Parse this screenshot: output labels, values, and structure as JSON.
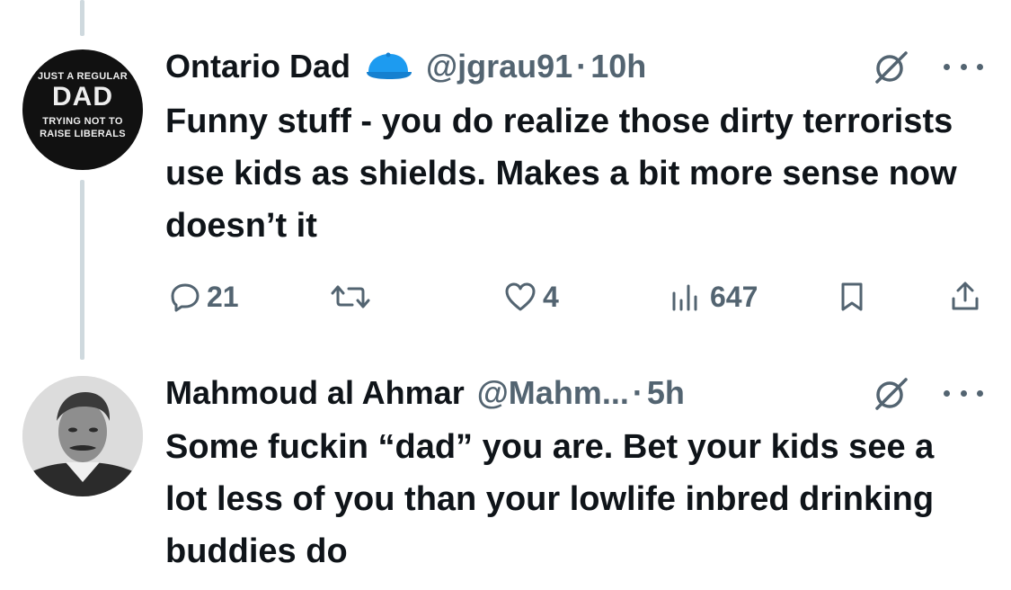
{
  "tweets": [
    {
      "author_name": "Ontario Dad",
      "verified_badge_icon": "blue-cap-icon",
      "handle": "@jgrau91",
      "separator": "·",
      "time": "10h",
      "text": "Funny stuff - you do realize those dirty terrorists use kids as shields. Makes a bit more sense now doesn’t it",
      "avatar_text": {
        "line1": "JUST A REGULAR",
        "line2": "DAD",
        "line3": "TRYING NOT TO",
        "line4": "RAISE LIBERALS"
      },
      "actions": {
        "reply_count": "21",
        "retweet_count": "",
        "like_count": "4",
        "views_count": "647"
      }
    },
    {
      "author_name": "Mahmoud al Ahmar",
      "handle": "@Mahm...",
      "separator": "·",
      "time": "5h",
      "text": "Some fuckin “dad” you are. Bet your kids see a lot less of you than your lowlife inbred drinking buddies do",
      "avatar_description": "portrait-photo"
    }
  ],
  "colors": {
    "text_primary": "#0f1419",
    "text_secondary": "#536471",
    "thread_line": "#cfd9de",
    "badge_blue": "#1d9bf0"
  }
}
